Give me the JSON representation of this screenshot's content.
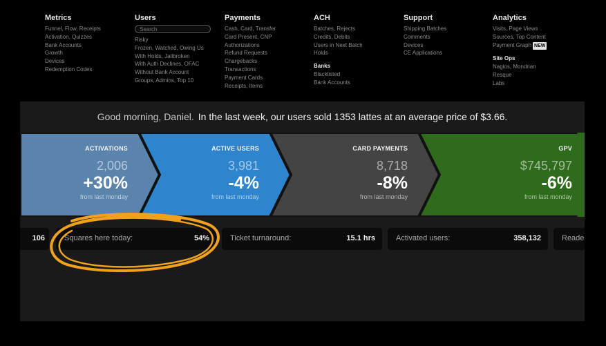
{
  "nav": {
    "columns": [
      {
        "title": "Metrics",
        "sections": [
          {
            "items": [
              "Funnel, Flow, Receipts",
              "Activation, Quizzes",
              "Bank Accounts",
              "Growth",
              "Devices",
              "Redemption Codes"
            ]
          }
        ]
      },
      {
        "title": "Users",
        "search_placeholder": "Search",
        "sections": [
          {
            "items": [
              "Risky",
              "Frozen, Watched, Owing Us",
              "With Holds, Jailbroken",
              "With Auth Declines, OFAC",
              "Without Bank Account",
              "Groups, Admins, Top 10"
            ]
          }
        ]
      },
      {
        "title": "Payments",
        "sections": [
          {
            "items": [
              "Cash, Card, Transfer",
              "Card Present, CNP",
              "Authorizations",
              "Refund Requests",
              "Chargebacks",
              "Transactions",
              "Payment Cards",
              "Receipts, Items"
            ]
          }
        ]
      },
      {
        "title": "ACH",
        "sections": [
          {
            "items": [
              "Batches, Rejects",
              "Credits, Debits",
              "Users in Next Batch",
              "Holds"
            ]
          },
          {
            "heading": "Banks",
            "items": [
              "Blacklisted",
              "Bank Accounts"
            ]
          }
        ]
      },
      {
        "title": "Support",
        "sections": [
          {
            "items": [
              "Shipping Batches",
              "Comments",
              "Devices",
              "CE Applications"
            ]
          }
        ]
      },
      {
        "title": "Analytics",
        "sections": [
          {
            "items": [
              "Visits, Page Views",
              "Sources, Top Content",
              "Payment Graph"
            ]
          },
          {
            "heading": "Site Ops",
            "items": [
              "Nagios, Mondrian",
              "Resque",
              "Labs"
            ]
          }
        ],
        "badge": "NEW"
      }
    ]
  },
  "greeting": {
    "salutation": "Good morning, Daniel.",
    "summary": "In the last week, our users sold 1353 lattes at an average price of $3.66."
  },
  "stats": [
    {
      "label": "ACTIVATIONS",
      "value": "2,006",
      "change": "+30%",
      "note": "from last monday",
      "color": "#5b84ad"
    },
    {
      "label": "ACTIVE USERS",
      "value": "3,981",
      "change": "-4%",
      "note": "from last monday",
      "color": "#2e85cd"
    },
    {
      "label": "CARD PAYMENTS",
      "value": "8,718",
      "change": "-8%",
      "note": "from last monday",
      "color": "#444444"
    },
    {
      "label": "GPV",
      "value": "$745,797",
      "change": "-6%",
      "note": "from last monday",
      "color": "#2f6b1c"
    }
  ],
  "tiles": [
    {
      "label": "",
      "value": "106"
    },
    {
      "label": "Squares here today:",
      "value": "54%"
    },
    {
      "label": "Ticket turnaround:",
      "value": "15.1 hrs"
    },
    {
      "label": "Activated users:",
      "value": "358,132"
    },
    {
      "label": "Reade",
      "value": ""
    }
  ],
  "annotation_color": "#f0a21e"
}
